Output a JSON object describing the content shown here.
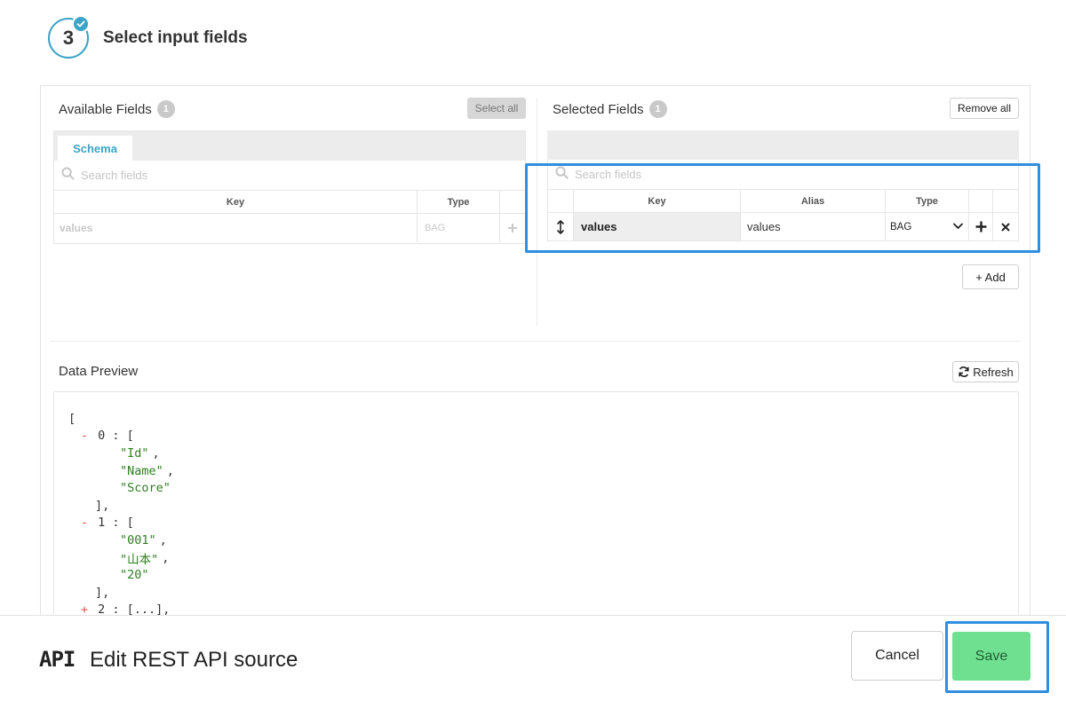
{
  "step": {
    "number": "3",
    "title": "Select input fields"
  },
  "available": {
    "title": "Available Fields",
    "count": "1",
    "select_all_label": "Select all",
    "tab_label": "Schema",
    "search_placeholder": "Search fields",
    "columns": {
      "key": "Key",
      "type": "Type"
    },
    "rows": [
      {
        "key": "values",
        "type": "BAG"
      }
    ]
  },
  "selected": {
    "title": "Selected Fields",
    "count": "1",
    "remove_all_label": "Remove all",
    "search_placeholder": "Search fields",
    "columns": {
      "key": "Key",
      "alias": "Alias",
      "type": "Type"
    },
    "rows": [
      {
        "key": "values",
        "alias": "values",
        "type": "BAG"
      }
    ],
    "add_label": "+ Add"
  },
  "preview": {
    "title": "Data Preview",
    "refresh_label": "Refresh",
    "lines": {
      "l1": "[",
      "l2_toggle": "-",
      "l2_text": "0 : [",
      "l3": "\"Id\"",
      "l3_comma": ",",
      "l4": "\"Name\"",
      "l4_comma": ",",
      "l5": "\"Score\"",
      "l6": "],",
      "l7_toggle": "-",
      "l7_text": "1 : [",
      "l8": "\"001\"",
      "l8_comma": ",",
      "l9": "\"山本\"",
      "l9_comma": ",",
      "l10": "\"20\"",
      "l11": "],",
      "l12_toggle": "+",
      "l12_text": "2 : [...],"
    }
  },
  "footer": {
    "logo_text": "API",
    "title": "Edit REST API source",
    "cancel_label": "Cancel",
    "save_label": "Save"
  },
  "colors": {
    "accent": "#3aa5c6",
    "highlight": "#2e8ee0",
    "save_green": "#6fe090",
    "string_green": "#2e7d1f",
    "toggle_red": "#d9534f"
  }
}
